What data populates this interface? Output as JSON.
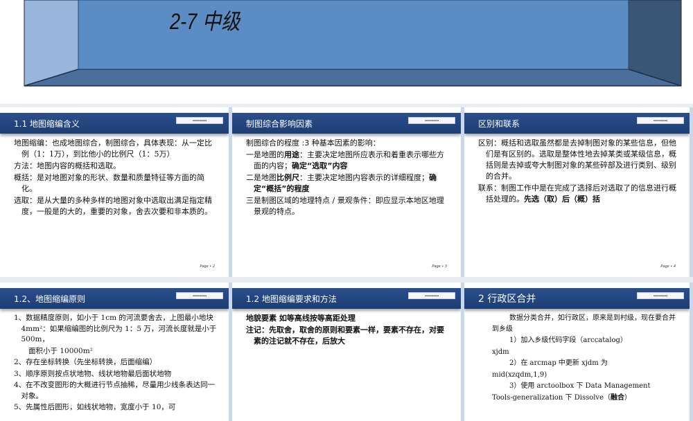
{
  "title_slide": {
    "title": "2-7 中级"
  },
  "logo_text": "中国科学院计算技术研究所教育中心",
  "slides": [
    {
      "header": "1.1 地图缩编含义",
      "page": "Page • 2",
      "lines": [
        "地图缩编：也成地图综合，制图综合，具体表现：从一定比例（1：1万），到比他小的比例尺（1：5万）",
        "方法：地图内容的概括和选取。",
        "概括：是对地图对象的形状、数量和质量特征等方面的简化。",
        "选取：是从大量的多种多样的地图对象中选取出满足指定精度，一般是的大的，重要的对象，舍去次要和非本质的。"
      ]
    },
    {
      "header": "制图综合影响因素",
      "page": "Page • 3",
      "l1": "制图综合的程度 :3 种基本因素的影响：",
      "l2a": "一是地图的",
      "l2b": "用途",
      "l2c": "：主要决定地图所应表示和着重表示哪些方面的内容；",
      "l2d": "确定“选取”内容",
      "l3a": "二是地图",
      "l3b": "比例尺",
      "l3c": "：主要决定地图内容表示的详细程度；",
      "l3d": "确定“概括”的程度",
      "l4": "三是制图区域的地理特点 / 景观条件：即应显示本地区地理景观的特点。"
    },
    {
      "header": "区别和联系",
      "page": "Page • 4",
      "l1": "区别：概括和选取虽然都是去掉制图对象的某些信息，但他们是有区别的。选取是整体性地去掉某类或某级信息，概括则是去掉或夸大制图对象的某些碎部及进行类别、级别的合并。",
      "l2a": "联系：制图工作中是在完成了选择后对选取了的信息进行概括处理的。",
      "l2b": "先选（取）后（概）括"
    },
    {
      "header": "1.2、地图缩编原则",
      "lines": [
        "1、数据精度原则，如小于 1cm 的河流要舍去，上图最小地块 4mm²：如果缩编图的比例尺为 1：5 万，河流长度就是小于 500m，",
        "面积小于 10000m²",
        "2、存在坐标转换（先坐标转换，后面缩编）",
        "3、顺序原则按点状地物、线状地物最后面状地物",
        "4、在不改变图形的大概进行节点抽稀，尽量用少线条表达同一对象。",
        "5、先属性后图形，如线状地物，宽度小于 10，可"
      ]
    },
    {
      "header": "1.2  地图缩编要求和方法",
      "lines": [
        "地貌要素  如等高线按等高距处理",
        "注记：先取舍，取舍的原则和要素一样，要素不存在，对要素的注记就不存在，后放大"
      ]
    },
    {
      "header": "2  行政区合并",
      "l1": "数据分类合并，如行政区，原来是到村级，现在要合并到乡级",
      "l2": "1）加入乡级代码字段（arccatalog）",
      "l3": "xjdm",
      "l4": "2）在 arcmap 中更新 xjdm 为",
      "l5": "mid(xzqdm,1,9)",
      "l6": "3）使用 arctoolbox 下 Data Management",
      "l7a": "Tools-generalization 下 Dissolve（",
      "l7b": "融合",
      "l7c": "）"
    }
  ]
}
